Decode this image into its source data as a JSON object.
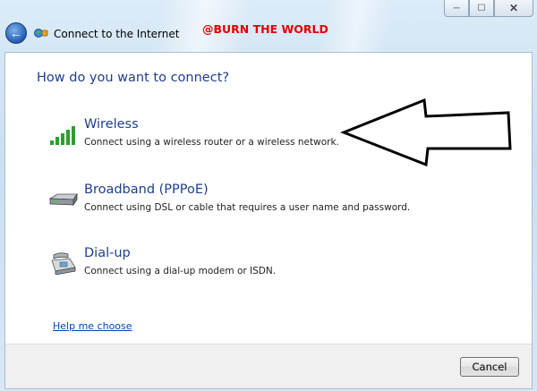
{
  "window": {
    "title": "Connect to the Internet",
    "watermark": "@BURN THE WORLD",
    "caption_minimize": "─",
    "caption_maximize": "☐",
    "caption_close": "✕",
    "back_glyph": "←"
  },
  "main": {
    "heading": "How do you want to connect?",
    "options": [
      {
        "title": "Wireless",
        "description": "Connect using a wireless router or a wireless network.",
        "icon": "wireless-signal-icon"
      },
      {
        "title": "Broadband (PPPoE)",
        "description": "Connect using DSL or cable that requires a user name and password.",
        "icon": "broadband-modem-icon"
      },
      {
        "title": "Dial-up",
        "description": "Connect using a dial-up modem or ISDN.",
        "icon": "dialup-phone-icon"
      }
    ],
    "help_link": "Help me choose"
  },
  "footer": {
    "cancel_label": "Cancel"
  },
  "colors": {
    "heading": "#1e3e8c",
    "watermark": "#e00000",
    "link": "#0645ad",
    "signal_green": "#2e9e2e"
  }
}
